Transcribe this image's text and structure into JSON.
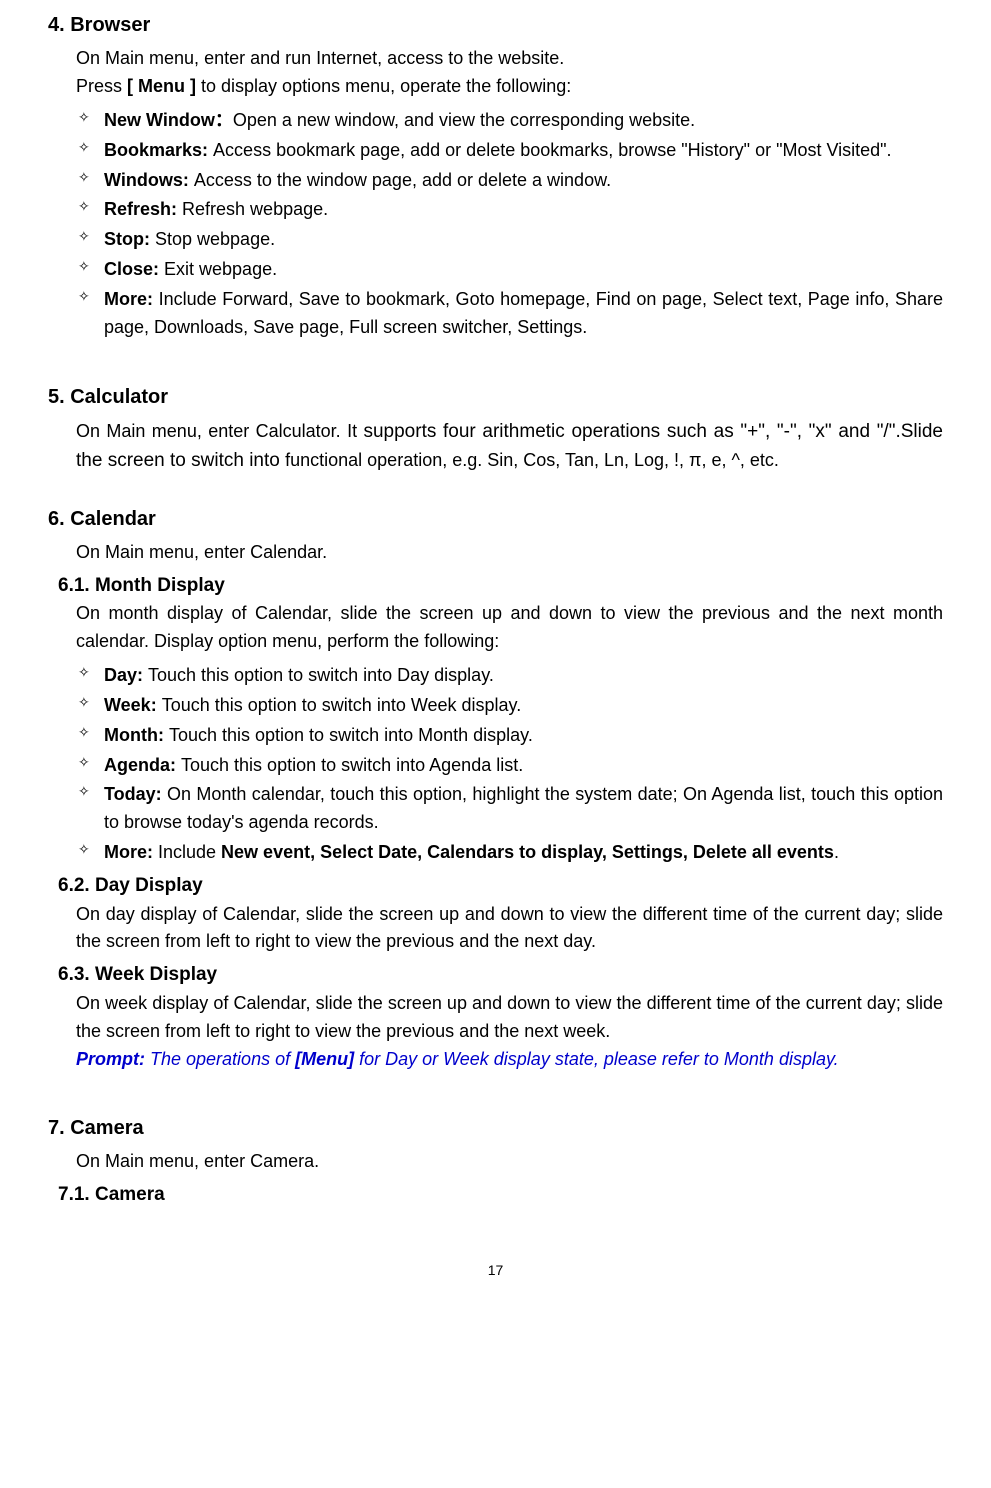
{
  "sections": {
    "browser": {
      "heading": "4.    Browser",
      "intro1_pre": "On Main menu, ",
      "intro1_enter": "enter",
      "intro1_post": " and run Internet, access to the website.",
      "intro2_pre": "Press ",
      "intro2_bold": "[ Menu ]",
      "intro2_post": " to display options menu, operate the following:",
      "items": [
        {
          "label": "New Window：",
          "text": "Open a new window, and view the corresponding website."
        },
        {
          "label": "Bookmarks: ",
          "text": "Access bookmark page, add or delete bookmarks, browse \"History\" or \"Most Visited\"."
        },
        {
          "label": "Windows: ",
          "text": "Access to the window page, add or delete a window."
        },
        {
          "label": "Refresh: ",
          "text": "Refresh webpage."
        },
        {
          "label": "Stop: ",
          "text": "Stop webpage."
        },
        {
          "label": "Close: ",
          "text": "Exit webpage."
        },
        {
          "label": "More: ",
          "text": "Include Forward, Save to bookmark, Goto homepage, Find on page, Select text, Page info, Share page, Downloads, Save page, Full screen switcher, Settings."
        }
      ]
    },
    "calculator": {
      "heading": "5.    Calculator",
      "text_pre": "On Main menu, enter Calculator. It ",
      "text_mid": "supports four arithmetic operations such as \"+\", \"-\", \"x\" and \"/\".Slide the screen to switch into ",
      "text_post": "functional operation, e.g. Sin, Cos, Tan, Ln, Log, !, π, e, ^, etc."
    },
    "calendar": {
      "heading": "6.    Calendar",
      "intro": "On Main menu, enter Calendar.",
      "month": {
        "heading": "6.1.   Month Display",
        "intro": "On month display of Calendar, slide the screen up and down to view the previous and the next month calendar. Display option menu, perform the following:",
        "items": [
          {
            "label": "Day: ",
            "text": "Touch this option to switch into Day display."
          },
          {
            "label": "Week: ",
            "text": "Touch this option to switch into Week display."
          },
          {
            "label": "Month: ",
            "text": "Touch this option to switch into Month display."
          },
          {
            "label": "Agenda: ",
            "text": "Touch this option to switch into Agenda list."
          },
          {
            "label": "Today: ",
            "text": "On Month calendar, touch this option, highlight the system date; On Agenda list, touch this option to browse today's agenda records."
          },
          {
            "label": "More: ",
            "text_pre": "Include ",
            "text_bold": "New event, Select Date, Calendars to display, Settings, Delete all events",
            "text_post": "."
          }
        ]
      },
      "day": {
        "heading": "6.2.   Day Display",
        "text": "On day display of Calendar, slide the screen up and down to view the different time of the current day; slide the screen from left to right to view the previous and the next day."
      },
      "week": {
        "heading": "6.3.    Week Display",
        "text": "On week display of Calendar, slide the screen up and down to view the different time of the current day; slide the screen from left to right to view the previous and the next week.",
        "prompt_pre": "Prompt:",
        "prompt_mid1": " The operations of ",
        "prompt_bold": "[Menu]",
        "prompt_mid2": " for Day or Week display state, please refer to Month display."
      }
    },
    "camera": {
      "heading": "7.    Camera",
      "intro": "On Main menu, enter Camera.",
      "sub": {
        "heading": "7.1.    Camera"
      }
    }
  },
  "page_number": "17"
}
